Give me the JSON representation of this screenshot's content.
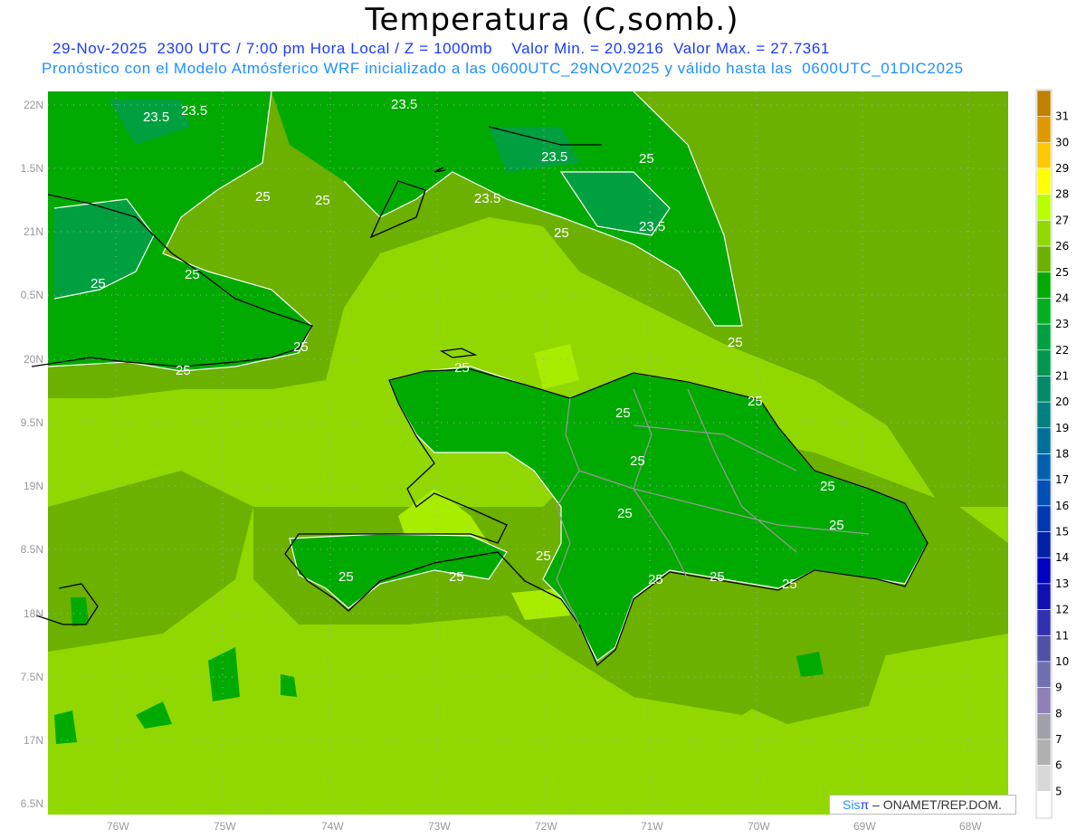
{
  "header": {
    "title": "Temperatura (C,somb.)",
    "subtitle_line1": "29-Nov-2025  2300 UTC / 7:00 pm Hora Local / Z = 1000mb    Valor Min. = 20.9216  Valor Max. = 27.7361",
    "subtitle_line2": "Pronóstico con el Modelo Atmósferico WRF inicializado a las 0600UTC_29NOV2025 y válido hasta las  0600UTC_01DIC2025"
  },
  "map": {
    "lon_ticks": [
      "76W",
      "75W",
      "74W",
      "73W",
      "72W",
      "71W",
      "70W",
      "69W",
      "68W"
    ],
    "lat_ticks": [
      "22N",
      "1.5N",
      "21N",
      "0.5N",
      "20N",
      "9.5N",
      "19N",
      "8.5N",
      "18N",
      "7.5N",
      "17N",
      "6.5N"
    ],
    "contour_labels": [
      "23.5",
      "23.5",
      "23.5",
      "25",
      "25",
      "23.5",
      "25",
      "23.5",
      "25",
      "23.5",
      "25",
      "25",
      "25",
      "25",
      "25",
      "25",
      "25",
      "25",
      "25",
      "25",
      "25",
      "25",
      "25",
      "25",
      "25",
      "25",
      "25",
      "25"
    ],
    "colors": {
      "land_dark": "#6CB000",
      "sea_light": "#90D800",
      "green": "#00AA00",
      "green_dark": "#00A040",
      "coast": "#000000",
      "border": "#999999"
    }
  },
  "colorbar": {
    "labels": [
      "31",
      "30",
      "29",
      "28",
      "27",
      "26",
      "25",
      "24",
      "23",
      "22",
      "21",
      "20",
      "19",
      "18",
      "17",
      "16",
      "15",
      "14",
      "13",
      "12",
      "11",
      "10",
      "9",
      "8",
      "7",
      "6",
      "5"
    ],
    "colors": [
      "#C08000",
      "#E09800",
      "#FFC800",
      "#FFFF00",
      "#B8FF00",
      "#90D800",
      "#6CB000",
      "#00AA00",
      "#00B020",
      "#00A040",
      "#009650",
      "#008A68",
      "#008080",
      "#007098",
      "#0060B0",
      "#0050B8",
      "#0038B0",
      "#0020A8",
      "#0000C0",
      "#1010B0",
      "#3030B0",
      "#5050A8",
      "#7070B0",
      "#9080B8",
      "#A0A0A8",
      "#B0B0B0",
      "#D8D8D8",
      "#FFFFFF"
    ]
  },
  "credit": {
    "sis": "Sis",
    "pi": "π",
    "rest": " –  ONAMET/REP.DOM."
  }
}
